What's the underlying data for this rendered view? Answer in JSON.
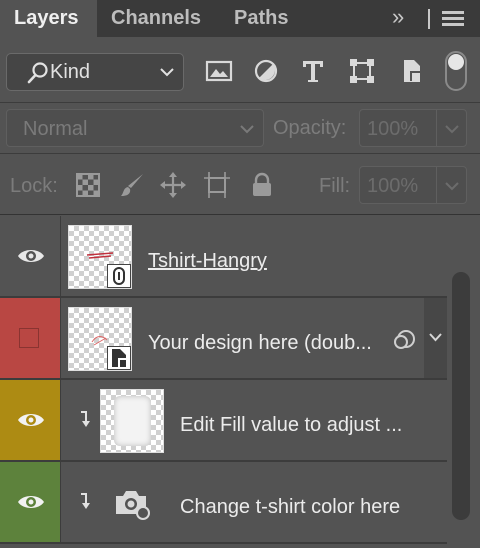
{
  "tabs": [
    {
      "label": "Layers",
      "active": true
    },
    {
      "label": "Channels",
      "active": false
    },
    {
      "label": "Paths",
      "active": false
    }
  ],
  "tab_overflow_icon": "double-chevron-right",
  "panel_menu_icon": "hamburger",
  "filter": {
    "kind_label": "Kind",
    "icons": [
      "image-filter-icon",
      "adjustment-filter-icon",
      "type-filter-icon",
      "shape-filter-icon",
      "smart-object-filter-icon"
    ],
    "toggle_on": true
  },
  "blend": {
    "mode": "Normal",
    "opacity_label": "Opacity:",
    "opacity_value": "100%"
  },
  "lock": {
    "label": "Lock:",
    "icons": [
      "lock-transparent-pixels-icon",
      "lock-image-pixels-icon",
      "lock-position-icon",
      "lock-artboard-icon",
      "lock-all-icon"
    ],
    "fill_label": "Fill:",
    "fill_value": "100%"
  },
  "layers": [
    {
      "name": "Tshirt-Hangry",
      "visible": true,
      "label_color": "none",
      "type": "linked-smart-object",
      "clipped": false
    },
    {
      "name": "Your design here (doub...",
      "visible": false,
      "label_color": "#b94743",
      "type": "smart-object",
      "clipped": false
    },
    {
      "name": "Edit Fill value to adjust ...",
      "visible": true,
      "label_color": "#ad8b13",
      "type": "pixel",
      "clipped": true
    },
    {
      "name": "Change t-shirt color here",
      "visible": true,
      "label_color": "#5d823c",
      "type": "adjustment",
      "clipped": true
    }
  ],
  "colors": {
    "panel_bg": "#535353",
    "tab_bar_bg": "#3a3a3a",
    "label_red": "#b94743",
    "label_yellow": "#ad8b13",
    "label_green": "#5d823c"
  }
}
